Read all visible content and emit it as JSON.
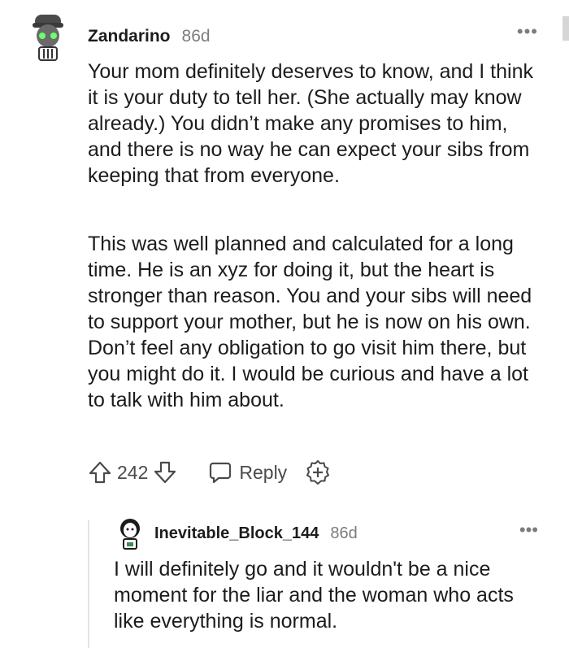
{
  "comment": {
    "author": "Zandarino",
    "age": "86d",
    "paragraphs": [
      "Your mom definitely deserves to know, and I think it is your duty to tell her. (She actually may know already.) You didn’t make any promises to him, and there is no way he can expect your sibs from keeping that from everyone.",
      "This was well planned and calculated for a long time. He is an xyz for doing it, but the heart is stronger than reason. You and your sibs will need to support your mother, but he is now on his own. Don’t feel any obligation to go visit him there, but you might do it. I would be curious and have a lot to talk with him about."
    ],
    "votes": "242",
    "reply_label": "Reply",
    "more_label": "•••"
  },
  "reply": {
    "author": "Inevitable_Block_144",
    "age": "86d",
    "text": "I will definitely go and it wouldn't be a nice moment for the liar and the woman who acts like everything is normal.",
    "more_label": "•••"
  },
  "icons": {
    "upvote": "arrow-up-icon",
    "downvote": "arrow-down-icon",
    "reply": "speech-bubble-icon",
    "award": "award-plus-icon",
    "more": "ellipsis-icon"
  }
}
